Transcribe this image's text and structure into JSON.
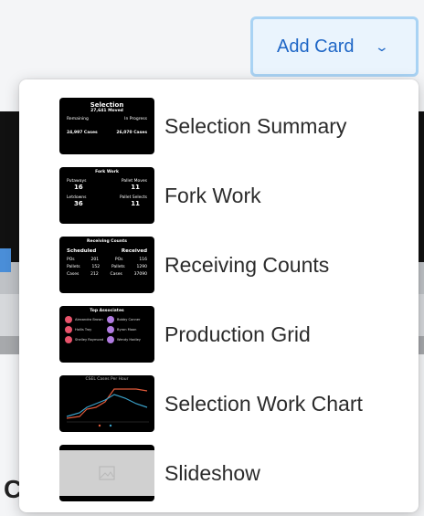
{
  "add_card": {
    "label": "Add Card",
    "chevron_icon": "chevron-down-icon"
  },
  "menu": {
    "items": [
      {
        "label": "Selection Summary",
        "thumb": {
          "title": "Selection",
          "subtitle": "27,641 Moved",
          "left_label": "Remaining",
          "right_label": "In Progress",
          "left_value": "24,997 Cases",
          "right_value": "26,070 Cases"
        }
      },
      {
        "label": "Fork Work",
        "thumb": {
          "title": "Fork Work",
          "cells": [
            {
              "label": "Putaways",
              "value": "16"
            },
            {
              "label": "Pallet Moves",
              "value": "11"
            },
            {
              "label": "Letdowns",
              "value": "36"
            },
            {
              "label": "Pallet Selects",
              "value": "11"
            }
          ]
        }
      },
      {
        "label": "Receiving Counts",
        "thumb": {
          "title": "Receiving Counts",
          "left_head": "Scheduled",
          "right_head": "Received",
          "rows": [
            {
              "label": "POs",
              "left": "201",
              "right_label": "POs",
              "right": "116"
            },
            {
              "label": "Pallets",
              "left": "152",
              "right_label": "Pallets",
              "right": "1290"
            },
            {
              "label": "Cases",
              "left": "212",
              "right_label": "Cases",
              "right": "37090"
            }
          ]
        }
      },
      {
        "label": "Production Grid",
        "thumb": {
          "title": "Top Associates",
          "people": [
            {
              "name": "Alexandra Brown",
              "color": "#e8536b"
            },
            {
              "name": "Bobby Conner",
              "color": "#b07be0"
            },
            {
              "name": "Hollis Troy",
              "color": "#e8536b"
            },
            {
              "name": "Byron Moon",
              "color": "#b07be0"
            },
            {
              "name": "Shelley Raymond",
              "color": "#e8536b"
            },
            {
              "name": "Wendy Hadley",
              "color": "#b07be0"
            }
          ]
        }
      },
      {
        "label": "Selection Work Chart",
        "thumb": {
          "title": "CSEL Cases Per Hour",
          "line_colors": [
            "#e05a3a",
            "#3aa0c8"
          ]
        }
      },
      {
        "label": "Slideshow",
        "thumb": {
          "placeholder_icon": "image-placeholder-icon"
        }
      }
    ]
  }
}
